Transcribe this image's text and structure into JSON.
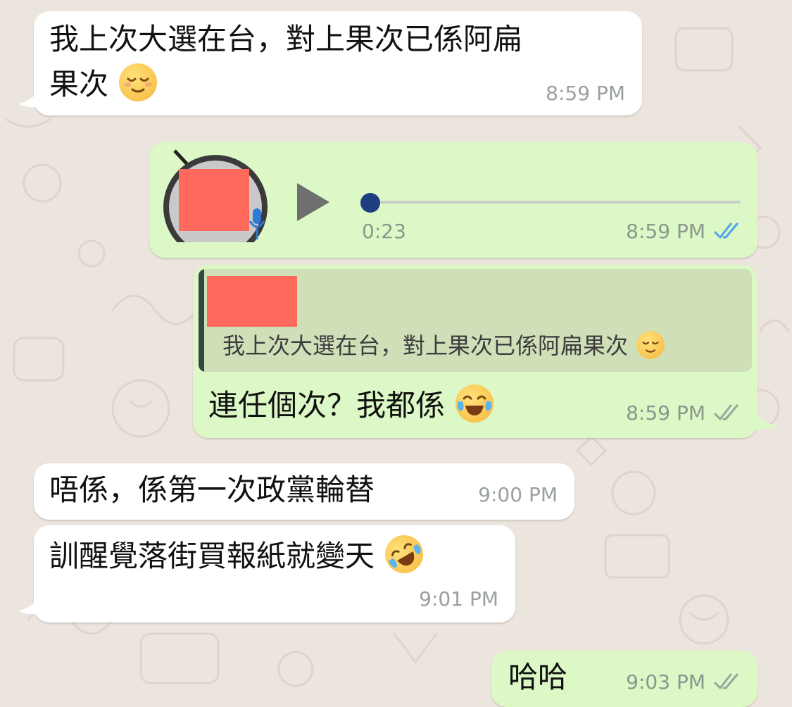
{
  "colors": {
    "wallpaper": "#ece5dd",
    "incoming_bubble": "#ffffff",
    "outgoing_bubble": "#dcf8c6",
    "quote_bar": "#2e4a3c",
    "read_ticks": "#4fa3ea",
    "sent_ticks": "#9aa59a",
    "voice_dot": "#1e3e80"
  },
  "messages": [
    {
      "line1": "我上次大選在台，對上果次已係阿扁",
      "line2": "果次",
      "emoji": "relieved-face-emoji",
      "time": "8:59 PM"
    },
    {
      "type": "voice",
      "duration": "0:23",
      "time": "8:59 PM",
      "status": "read-ticks-icon",
      "progress": 0
    },
    {
      "quote": {
        "text": "我上次大選在台，對上果次已係阿扁果次",
        "emoji": "relieved-face-emoji"
      },
      "text": "連任個次？我都係",
      "emoji": "tears-of-joy-emoji",
      "time": "8:59 PM",
      "status": "delivered-ticks-icon"
    },
    {
      "text": "唔係，係第一次政黨輪替",
      "time": "9:00 PM"
    },
    {
      "text": "訓醒覺落街買報紙就變天",
      "emoji": "rolling-laughing-emoji",
      "time": "9:01 PM"
    },
    {
      "text": "哈哈",
      "time": "9:03 PM",
      "status": "delivered-ticks-icon"
    }
  ]
}
